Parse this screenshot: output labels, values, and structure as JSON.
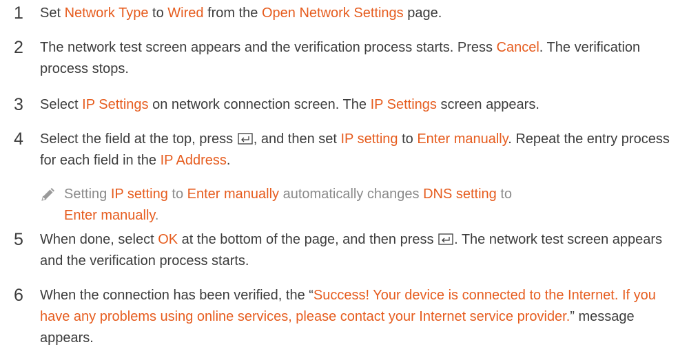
{
  "steps": [
    {
      "number": "1",
      "parts": [
        {
          "t": "Set "
        },
        {
          "t": "Network Type",
          "hl": true
        },
        {
          "t": " to "
        },
        {
          "t": "Wired",
          "hl": true
        },
        {
          "t": " from the "
        },
        {
          "t": "Open Network Settings",
          "hl": true
        },
        {
          "t": " page."
        }
      ]
    },
    {
      "number": "2",
      "parts": [
        {
          "t": "The network test screen appears and the verification process starts. Press "
        },
        {
          "t": "Cancel",
          "hl": true
        },
        {
          "t": ". The verification process stops."
        }
      ]
    },
    {
      "number": "3",
      "parts": [
        {
          "t": "Select "
        },
        {
          "t": "IP Settings",
          "hl": true
        },
        {
          "t": " on network connection screen. The "
        },
        {
          "t": "IP Settings",
          "hl": true
        },
        {
          "t": " screen appears."
        }
      ]
    },
    {
      "number": "4",
      "parts": [
        {
          "t": "Select the field at the top, press "
        },
        {
          "icon": "enter-icon"
        },
        {
          "t": ", and then set "
        },
        {
          "t": "IP setting",
          "hl": true
        },
        {
          "t": " to "
        },
        {
          "t": "Enter manually",
          "hl": true
        },
        {
          "t": ". Repeat the entry process for each field in the "
        },
        {
          "t": "IP Address",
          "hl": true
        },
        {
          "t": "."
        }
      ],
      "note": {
        "icon": "pencil-icon",
        "parts": [
          {
            "t": "Setting "
          },
          {
            "t": "IP setting",
            "hl": true
          },
          {
            "t": " to "
          },
          {
            "t": "Enter manually",
            "hl": true
          },
          {
            "t": " automatically changes "
          },
          {
            "t": "DNS setting",
            "hl": true
          },
          {
            "t": " to "
          },
          {
            "t": "Enter manually",
            "hl": true
          },
          {
            "t": "."
          }
        ]
      }
    },
    {
      "number": "5",
      "parts": [
        {
          "t": "When done, select "
        },
        {
          "t": "OK",
          "hl": true
        },
        {
          "t": " at the bottom of the page, and then press "
        },
        {
          "icon": "enter-icon"
        },
        {
          "t": ". The network test screen appears and the verification process starts."
        }
      ]
    },
    {
      "number": "6",
      "parts": [
        {
          "t": "When the connection has been verified, the “"
        },
        {
          "t": "Success! Your device is connected to the Internet. If you have any problems using online services, please contact your Internet service provider.",
          "hl": true
        },
        {
          "t": "” message appears."
        }
      ]
    }
  ],
  "colors": {
    "highlight": "#e65c1e",
    "body_text": "#3c3c3c",
    "note_text": "#8a8a8a"
  }
}
